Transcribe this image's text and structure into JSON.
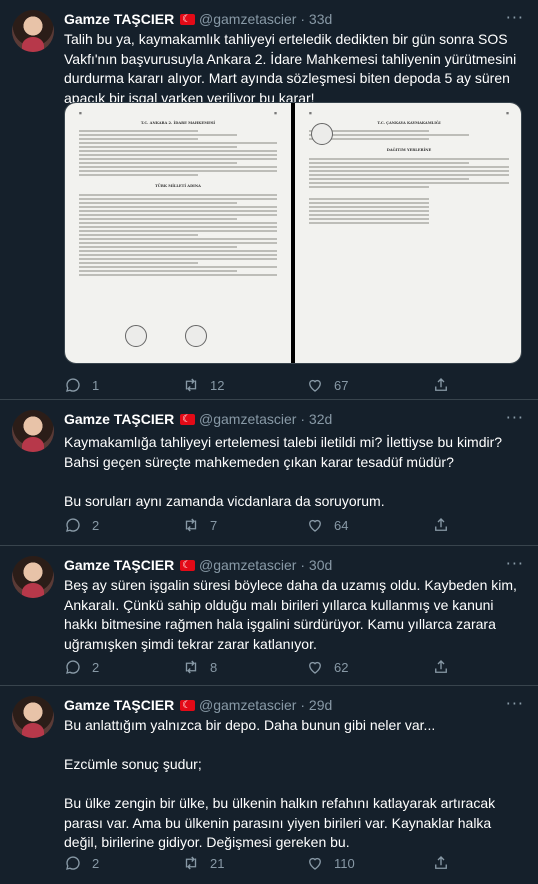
{
  "tweets": [
    {
      "name": "Gamze TAŞCIER",
      "handle": "@gamzetascier",
      "time": "· 33d",
      "text": [
        "Talih bu ya, kaymakamlık tahliyeyi erteledik dedikten bir gün sonra SOS Vakfı'nın başvurusuyla Ankara 2. İdare Mahkemesi tahliyenin yürütmesini durdurma kararı alıyor. Mart ayında sözleşmesi biten depoda 5 ay süren apaçık bir işgal varken veriliyor bu karar!"
      ],
      "replies": "1",
      "retweets": "12",
      "likes": "67",
      "has_media": true
    },
    {
      "name": "Gamze TAŞCIER",
      "handle": "@gamzetascier",
      "time": "· 32d",
      "text": [
        "Kaymakamlığa tahliyeyi ertelemesi talebi iletildi mi? İlettiyse bu kimdir? Bahsi geçen süreçte mahkemeden çıkan karar tesadüf müdür?",
        "",
        "Bu soruları aynı zamanda vicdanlara da soruyorum."
      ],
      "replies": "2",
      "retweets": "7",
      "likes": "64"
    },
    {
      "name": "Gamze TAŞCIER",
      "handle": "@gamzetascier",
      "time": "· 30d",
      "text": [
        "Beş ay süren işgalin süresi böylece daha da uzamış oldu. Kaybeden kim, Ankaralı. Çünkü sahip olduğu malı birileri yıllarca kullanmış ve kanuni hakkı bitmesine rağmen hala işgalini sürdürüyor. Kamu yıllarca zarara uğramışken şimdi tekrar zarar katlanıyor."
      ],
      "replies": "2",
      "retweets": "8",
      "likes": "62"
    },
    {
      "name": "Gamze TAŞCIER",
      "handle": "@gamzetascier",
      "time": "· 29d",
      "text": [
        "Bu anlattığım yalnızca bir depo. Daha bunun gibi neler var...",
        "",
        "Ezcümle sonuç şudur;",
        "",
        "Bu ülke zengin bir ülke, bu ülkenin halkın refahını katlayarak artıracak parası var. Ama bu ülkenin parasını yiyen birileri var. Kaynaklar halka değil, birilerine gidiyor. Değişmesi gereken bu."
      ],
      "replies": "2",
      "retweets": "21",
      "likes": "110"
    }
  ],
  "media": {
    "left_doc": {
      "court": "T.C. ANKARA 2. İDARE MAHKEMESİ",
      "title": "TÜRK MİLLETİ ADINA"
    },
    "right_doc": {
      "office": "T.C. ÇANKAYA KAYMAKAMLIĞI",
      "title": "DAĞITIM YERLERİNE"
    }
  },
  "colors": {
    "background": "#15202b",
    "border": "#38444d",
    "secondary_text": "#8899a6"
  },
  "icons": [
    "reply-icon",
    "retweet-icon",
    "like-icon",
    "share-icon",
    "more-icon",
    "turkish-flag-icon"
  ]
}
